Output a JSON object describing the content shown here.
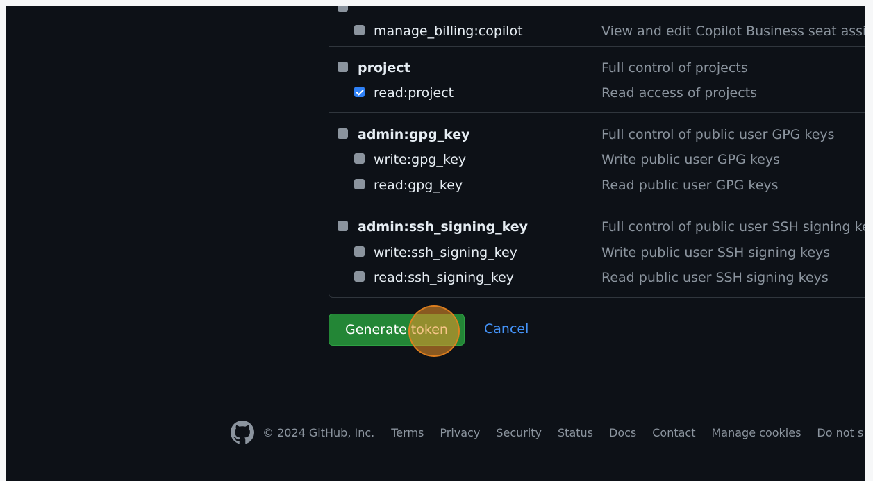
{
  "scope_groups": [
    {
      "parent": {
        "name": "",
        "description": "",
        "checked": false
      },
      "children": [
        {
          "name": "manage_billing:copilot",
          "description": "View and edit Copilot Business seat assig",
          "checked": false
        }
      ]
    },
    {
      "parent": {
        "name": "project",
        "description": "Full control of projects",
        "checked": false
      },
      "children": [
        {
          "name": "read:project",
          "description": "Read access of projects",
          "checked": true
        }
      ]
    },
    {
      "parent": {
        "name": "admin:gpg_key",
        "description": "Full control of public user GPG keys",
        "checked": false
      },
      "children": [
        {
          "name": "write:gpg_key",
          "description": "Write public user GPG keys",
          "checked": false
        },
        {
          "name": "read:gpg_key",
          "description": "Read public user GPG keys",
          "checked": false
        }
      ]
    },
    {
      "parent": {
        "name": "admin:ssh_signing_key",
        "description": "Full control of public user SSH signing ke",
        "checked": false
      },
      "children": [
        {
          "name": "write:ssh_signing_key",
          "description": "Write public user SSH signing keys",
          "checked": false
        },
        {
          "name": "read:ssh_signing_key",
          "description": "Read public user SSH signing keys",
          "checked": false
        }
      ]
    }
  ],
  "actions": {
    "generate_label": "Generate token",
    "cancel_label": "Cancel"
  },
  "footer": {
    "logo_icon": "github-mark-icon",
    "copyright": "© 2024 GitHub, Inc.",
    "links": [
      "Terms",
      "Privacy",
      "Security",
      "Status",
      "Docs",
      "Contact",
      "Manage cookies",
      "Do not s"
    ]
  },
  "colors": {
    "primary_button": "#238636",
    "link": "#4493f8",
    "checkbox_checked": "#2f81f7",
    "background": "#0d1117"
  }
}
